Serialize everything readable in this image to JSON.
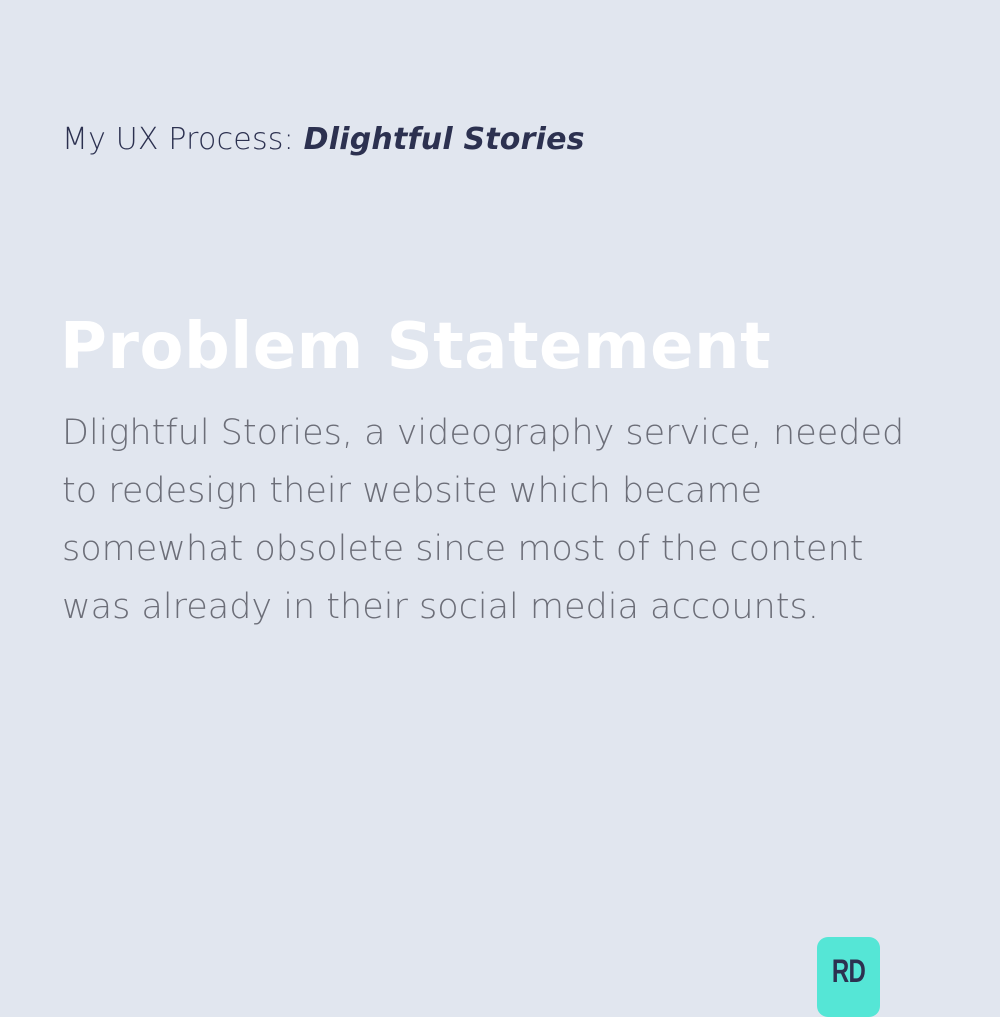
{
  "header": {
    "prefix": "My UX Process: ",
    "project": "Dlightful Stories"
  },
  "section": {
    "title": "Problem Statement",
    "body": "Dlightful Stories, a videography service, needed to redesign their website which became somewhat obsolete since most of the content was already in their social media accounts."
  },
  "logo": {
    "text": "RD",
    "color": "#55e6d6"
  },
  "colors": {
    "background": "#e1e6ef",
    "heading": "#ffffff",
    "text": "#6c6e78",
    "dark": "#2c3150"
  }
}
